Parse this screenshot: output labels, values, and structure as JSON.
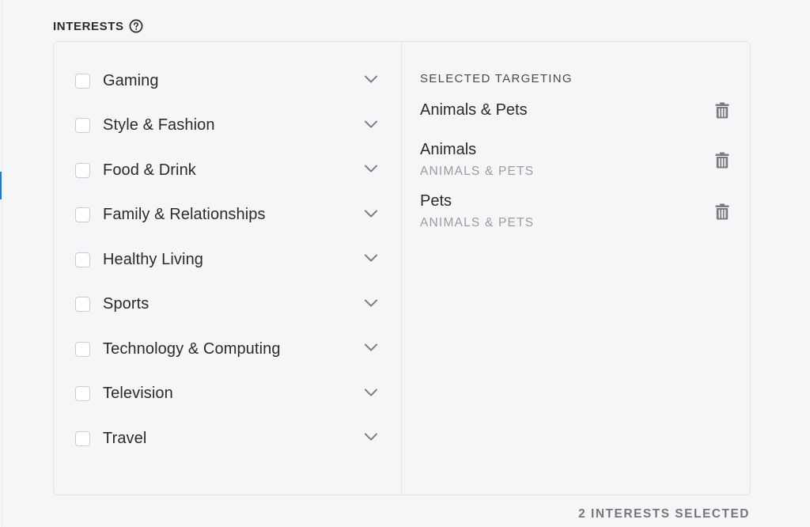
{
  "section": {
    "title": "INTERESTS",
    "help_icon": "help-circle-icon"
  },
  "categories": [
    {
      "label": "Gaming",
      "checked": false
    },
    {
      "label": "Style & Fashion",
      "checked": false
    },
    {
      "label": "Food & Drink",
      "checked": false
    },
    {
      "label": "Family & Relationships",
      "checked": false
    },
    {
      "label": "Healthy Living",
      "checked": false
    },
    {
      "label": "Sports",
      "checked": false
    },
    {
      "label": "Technology & Computing",
      "checked": false
    },
    {
      "label": "Television",
      "checked": false
    },
    {
      "label": "Travel",
      "checked": false
    }
  ],
  "selected": {
    "title": "SELECTED TARGETING",
    "items": [
      {
        "name": "Animals & Pets",
        "parent": ""
      },
      {
        "name": "Animals",
        "parent": "ANIMALS & PETS"
      },
      {
        "name": "Pets",
        "parent": "ANIMALS & PETS"
      }
    ]
  },
  "footer": {
    "count_text": "2 INTERESTS SELECTED"
  },
  "colors": {
    "background": "#f5f6f8",
    "border": "#e1e3e7",
    "accent": "#1a7fd4",
    "icon_gray": "#7a7c80",
    "muted_text": "#9a9ca0"
  }
}
